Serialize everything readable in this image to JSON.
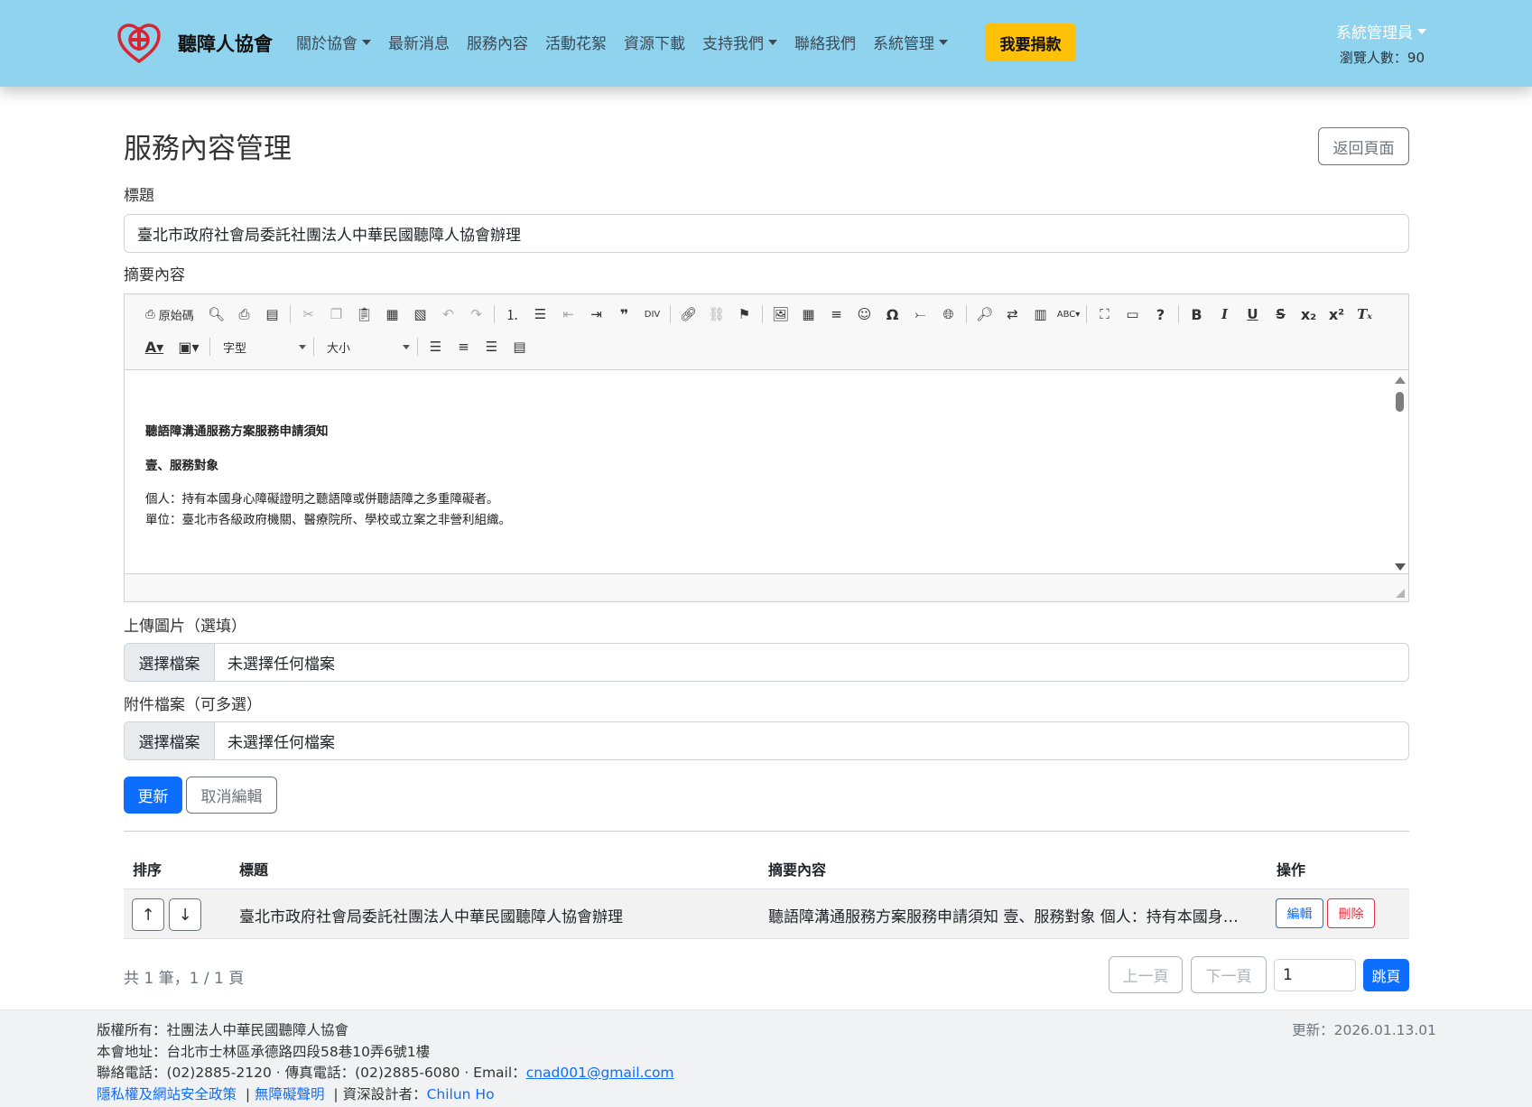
{
  "navbar": {
    "brand": "聽障人協會",
    "items": [
      {
        "label": "關於協會",
        "dropdown": true
      },
      {
        "label": "最新消息",
        "dropdown": false
      },
      {
        "label": "服務內容",
        "dropdown": false
      },
      {
        "label": "活動花絮",
        "dropdown": false
      },
      {
        "label": "資源下載",
        "dropdown": false
      },
      {
        "label": "支持我們",
        "dropdown": true
      },
      {
        "label": "聯絡我們",
        "dropdown": false
      },
      {
        "label": "系統管理",
        "dropdown": true
      }
    ],
    "donate": "我要捐款",
    "admin": "系統管理員",
    "visitors": "瀏覽人數：90",
    "colors": {
      "bar": "#8fd3ee",
      "donate": "#ffc107",
      "logo": "#d72631"
    }
  },
  "page": {
    "title": "服務內容管理",
    "back_button": "返回頁面"
  },
  "form": {
    "title_label": "標題",
    "title_value": "臺北市政府社會局委託社團法人中華民國聽障人協會辦理",
    "summary_label": "摘要內容",
    "image_label": "上傳圖片（選填）",
    "attach_label": "附件檔案（可多選）",
    "file_button": "選擇檔案",
    "file_none": "未選擇任何檔案",
    "update_button": "更新",
    "cancel_button": "取消編輯"
  },
  "editor": {
    "source_label": "原始碼",
    "font_combo": "字型",
    "size_combo": "大小",
    "content": {
      "heading": "聽語障溝通服務方案服務申請須知",
      "section": "壹、服務對象",
      "line1": "個人：持有本國身心障礙證明之聽語障或併聽語障之多重障礙者。",
      "line2": "單位：臺北市各級政府機關、醫療院所、學校或立案之非營利組織。"
    }
  },
  "table": {
    "headers": [
      "排序",
      "標題",
      "摘要內容",
      "操作"
    ],
    "rows": [
      {
        "up": "↑",
        "down": "↓",
        "title": "臺北市政府社會局委託社團法人中華民國聽障人協會辦理",
        "summary": "聽語障溝通服務方案服務申請須知 壹、服務對象 個人：持有本國身…",
        "edit": "編輯",
        "delete": "刪除"
      }
    ]
  },
  "pagination": {
    "summary": "共 1 筆，1 / 1 頁",
    "prev": "上一頁",
    "next": "下一頁",
    "page_input": "1",
    "jump": "跳頁"
  },
  "footer": {
    "copyright": "版權所有：社團法人中華民國聽障人協會",
    "address": "本會地址：台北市士林區承德路四段58巷10弄6號1樓",
    "contact_prefix": "聯絡電話：(02)2885-2120 · 傳真電話：(02)2885-6080 · Email：",
    "email": "cnad001@gmail.com",
    "privacy": "隱私權及網站安全政策",
    "accessibility": "無障礙聲明",
    "designer_prefix": "資深設計者：",
    "designer": "Chilun Ho",
    "updated": "更新：2026.01.13.01"
  }
}
